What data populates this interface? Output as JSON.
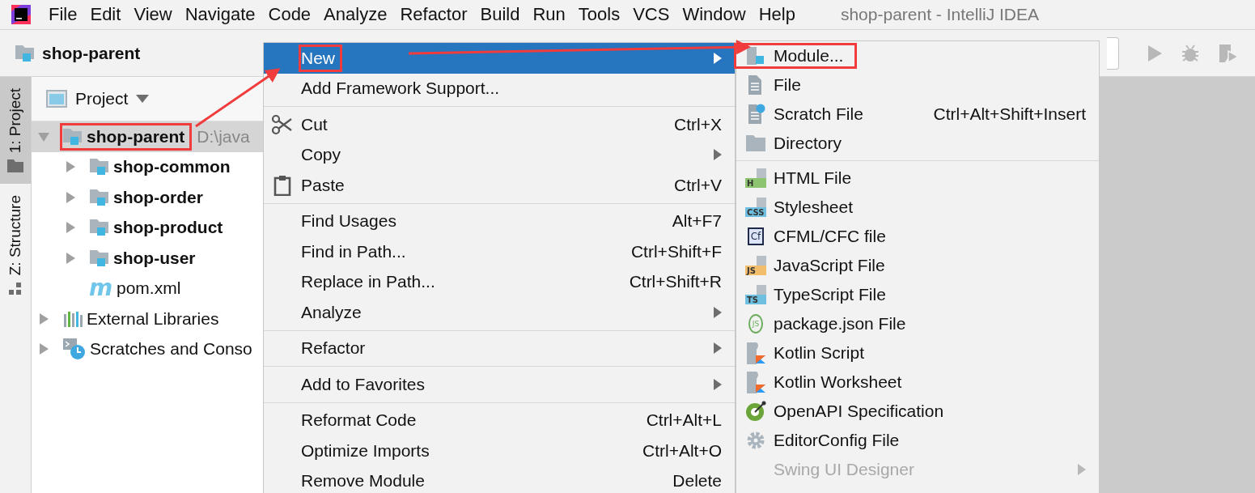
{
  "window": {
    "title": "shop-parent - IntelliJ IDEA"
  },
  "menubar": [
    "File",
    "Edit",
    "View",
    "Navigate",
    "Code",
    "Analyze",
    "Refactor",
    "Build",
    "Run",
    "Tools",
    "VCS",
    "Window",
    "Help"
  ],
  "breadcrumb": "shop-parent",
  "tool_tabs": [
    {
      "label": "1: Project",
      "selected": true,
      "kind": "project"
    },
    {
      "label": "Z: Structure",
      "selected": false,
      "kind": "structure"
    }
  ],
  "project_panel": {
    "title": "Project",
    "tree": [
      {
        "kind": "module",
        "name": "shop-parent",
        "path": "D:\\java",
        "selected": true,
        "callout": true,
        "expanded": true,
        "children": [
          {
            "kind": "module",
            "name": "shop-common",
            "selected": false,
            "callout": false,
            "expanded": false
          },
          {
            "kind": "module",
            "name": "shop-order",
            "selected": false,
            "callout": false,
            "expanded": false
          },
          {
            "kind": "module",
            "name": "shop-product",
            "selected": false,
            "callout": false,
            "expanded": false
          },
          {
            "kind": "module",
            "name": "shop-user",
            "selected": false,
            "callout": false,
            "expanded": false
          },
          {
            "kind": "maven",
            "badge": "m",
            "name": "pom.xml",
            "selected": false,
            "callout": false
          }
        ]
      },
      {
        "kind": "library",
        "name": "External Libraries",
        "selected": false,
        "callout": false,
        "expanded": false
      },
      {
        "kind": "scratches",
        "name": "Scratches and Conso",
        "selected": false,
        "callout": false,
        "expanded": false
      }
    ]
  },
  "context_menu": [
    {
      "kind": "plain",
      "label": "New",
      "submenu": true,
      "selected": true,
      "callout": true
    },
    {
      "kind": "plain",
      "label": "Add Framework Support...",
      "submenu": false,
      "selected": false,
      "callout": false
    },
    {
      "kind": "separator"
    },
    {
      "kind": "cut",
      "label": "Cut",
      "shortcut": "Ctrl+X",
      "submenu": false,
      "selected": false,
      "callout": false
    },
    {
      "kind": "plain",
      "label": "Copy",
      "submenu": true,
      "selected": false,
      "callout": false
    },
    {
      "kind": "paste",
      "label": "Paste",
      "shortcut": "Ctrl+V",
      "submenu": false,
      "selected": false,
      "callout": false
    },
    {
      "kind": "separator"
    },
    {
      "kind": "plain",
      "label": "Find Usages",
      "shortcut": "Alt+F7",
      "submenu": false,
      "selected": false,
      "callout": false
    },
    {
      "kind": "plain",
      "label": "Find in Path...",
      "shortcut": "Ctrl+Shift+F",
      "submenu": false,
      "selected": false,
      "callout": false
    },
    {
      "kind": "plain",
      "label": "Replace in Path...",
      "shortcut": "Ctrl+Shift+R",
      "submenu": false,
      "selected": false,
      "callout": false
    },
    {
      "kind": "plain",
      "label": "Analyze",
      "submenu": true,
      "selected": false,
      "callout": false
    },
    {
      "kind": "separator"
    },
    {
      "kind": "plain",
      "label": "Refactor",
      "submenu": true,
      "selected": false,
      "callout": false
    },
    {
      "kind": "separator"
    },
    {
      "kind": "plain",
      "label": "Add to Favorites",
      "submenu": true,
      "selected": false,
      "callout": false
    },
    {
      "kind": "separator"
    },
    {
      "kind": "plain",
      "label": "Reformat Code",
      "shortcut": "Ctrl+Alt+L",
      "submenu": false,
      "selected": false,
      "callout": false
    },
    {
      "kind": "plain",
      "label": "Optimize Imports",
      "shortcut": "Ctrl+Alt+O",
      "submenu": false,
      "selected": false,
      "callout": false
    },
    {
      "kind": "plain",
      "label": "Remove Module",
      "shortcut": "Delete",
      "submenu": false,
      "selected": false,
      "callout": false
    }
  ],
  "new_submenu": [
    {
      "kind": "module",
      "label": "Module...",
      "submenu": false,
      "disabled": false,
      "callout": true
    },
    {
      "kind": "file",
      "label": "File",
      "submenu": false,
      "disabled": false,
      "callout": false
    },
    {
      "kind": "scratch",
      "label": "Scratch File",
      "shortcut": "Ctrl+Alt+Shift+Insert",
      "submenu": false,
      "disabled": false,
      "callout": false
    },
    {
      "kind": "directory",
      "label": "Directory",
      "submenu": false,
      "disabled": false,
      "callout": false
    },
    {
      "kind": "separator"
    },
    {
      "kind": "filetype",
      "badge": "H",
      "color": "#8cc46f",
      "label": "HTML File",
      "submenu": false,
      "disabled": false,
      "callout": false
    },
    {
      "kind": "filetype",
      "badge": "CSS",
      "color": "#6fc0e0",
      "label": "Stylesheet",
      "submenu": false,
      "disabled": false,
      "callout": false
    },
    {
      "kind": "cfml",
      "badge": "Cf",
      "label": "CFML/CFC file",
      "submenu": false,
      "disabled": false,
      "callout": false
    },
    {
      "kind": "filetype",
      "badge": "JS",
      "color": "#f2be6b",
      "label": "JavaScript File",
      "submenu": false,
      "disabled": false,
      "callout": false
    },
    {
      "kind": "filetype",
      "badge": "TS",
      "color": "#6fc0e0",
      "label": "TypeScript File",
      "submenu": false,
      "disabled": false,
      "callout": false
    },
    {
      "kind": "node",
      "badge": "JS",
      "label": "package.json File",
      "submenu": false,
      "disabled": false,
      "callout": false
    },
    {
      "kind": "kotlin",
      "label": "Kotlin Script",
      "submenu": false,
      "disabled": false,
      "callout": false
    },
    {
      "kind": "kotlin",
      "label": "Kotlin Worksheet",
      "submenu": false,
      "disabled": false,
      "callout": false
    },
    {
      "kind": "openapi",
      "label": "OpenAPI Specification",
      "submenu": false,
      "disabled": false,
      "callout": false
    },
    {
      "kind": "gear",
      "label": "EditorConfig File",
      "submenu": false,
      "disabled": false,
      "callout": false
    },
    {
      "kind": "plain",
      "label": "Swing UI Designer",
      "submenu": true,
      "disabled": true,
      "callout": false
    }
  ]
}
